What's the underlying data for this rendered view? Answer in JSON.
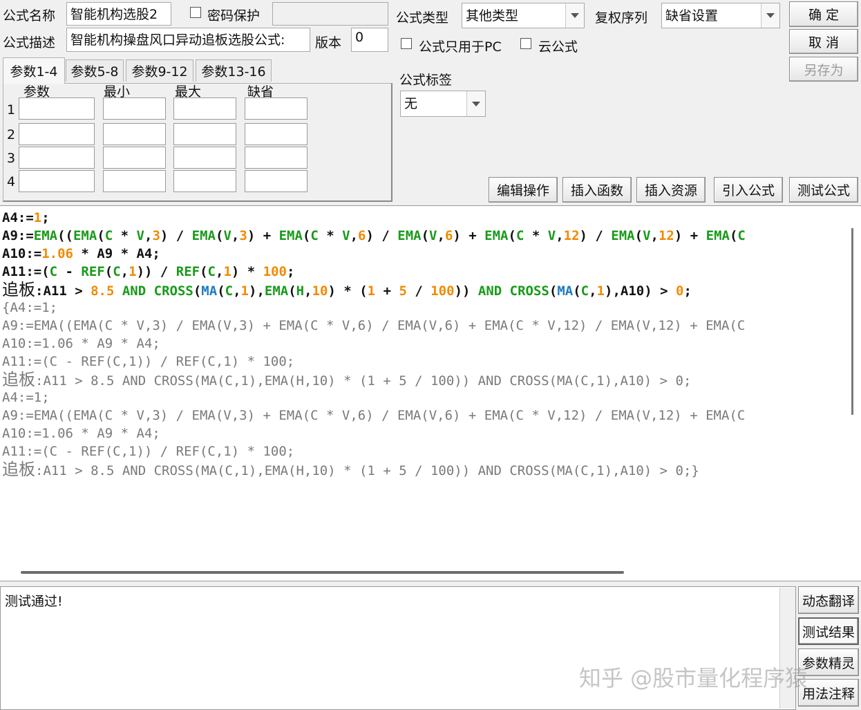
{
  "header": {
    "name_label": "公式名称",
    "name_value": "智能机构选股2",
    "password_label": "密码保护",
    "desc_label": "公式描述",
    "desc_value": "智能机构操盘风口异动追板选股公式:",
    "version_label": "版本",
    "version_value": "0",
    "type_label": "公式类型",
    "type_value": "其他类型",
    "fq_label": "复权序列",
    "fq_value": "缺省设置",
    "pc_only_label": "公式只用于PC",
    "cloud_label": "云公式",
    "tag_label": "公式标签",
    "tag_value": "无"
  },
  "buttons": {
    "ok": "确 定",
    "cancel": "取 消",
    "save_as": "另存为",
    "edit": "编辑操作",
    "insert_func": "插入函数",
    "insert_res": "插入资源",
    "import": "引入公式",
    "test": "测试公式"
  },
  "tabs": [
    "参数1-4",
    "参数5-8",
    "参数9-12",
    "参数13-16"
  ],
  "param_table": {
    "headers": [
      "参数",
      "最小",
      "最大",
      "缺省"
    ],
    "rows": [
      "1",
      "2",
      "3",
      "4"
    ]
  },
  "code_lines": [
    "A4:=1;",
    "A9:=EMA((EMA(C * V,3) / EMA(V,3) + EMA(C * V,6) / EMA(V,6) + EMA(C * V,12) / EMA(V,12) + EMA(C",
    "A10:=1.06 * A9 * A4;",
    "A11:=(C - REF(C,1)) / REF(C,1) * 100;",
    "追板:A11 > 8.5 AND CROSS(MA(C,1),EMA(H,10) * (1 + 5 / 100)) AND CROSS(MA(C,1),A10) > 0;",
    "{A4:=1;",
    "A9:=EMA((EMA(C * V,3) / EMA(V,3) + EMA(C * V,6) / EMA(V,6) + EMA(C * V,12) / EMA(V,12) + EMA(C",
    "A10:=1.06 * A9 * A4;",
    "A11:=(C - REF(C,1)) / REF(C,1) * 100;",
    "追板:A11 > 8.5 AND CROSS(MA(C,1),EMA(H,10) * (1 + 5 / 100)) AND CROSS(MA(C,1),A10) > 0;",
    "A4:=1;",
    "A9:=EMA((EMA(C * V,3) / EMA(V,3) + EMA(C * V,6) / EMA(V,6) + EMA(C * V,12) / EMA(V,12) + EMA(C",
    "A10:=1.06 * A9 * A4;",
    "A11:=(C - REF(C,1)) / REF(C,1) * 100;",
    "追板:A11 > 8.5 AND CROSS(MA(C,1),EMA(H,10) * (1 + 5 / 100)) AND CROSS(MA(C,1),A10) > 0;}"
  ],
  "result_text": "测试通过!",
  "side_buttons": [
    "动态翻译",
    "测试结果",
    "参数精灵",
    "用法注释"
  ],
  "watermark": "知乎 @股市量化程序猿",
  "colors": {
    "keyword": "#1a9a1a",
    "number": "#f08a00",
    "function2": "#1e7bc0",
    "comment": "#7a7a7a"
  }
}
